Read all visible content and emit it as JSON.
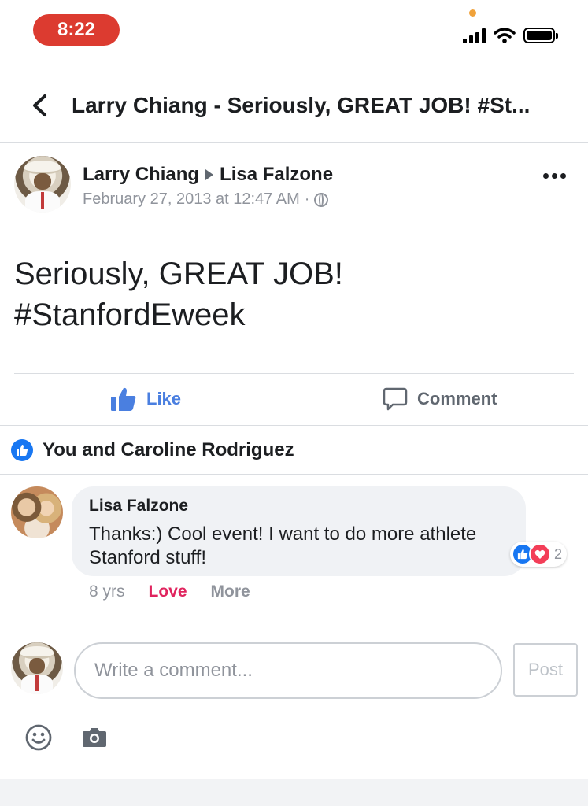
{
  "status_bar": {
    "time": "8:22"
  },
  "header": {
    "title": "Larry Chiang - Seriously, GREAT JOB! #St..."
  },
  "post": {
    "author": "Larry Chiang",
    "recipient": "Lisa Falzone",
    "timestamp": "February 27, 2013 at 12:47 AM",
    "separator": "·",
    "text_line1": "Seriously, GREAT JOB!",
    "text_line2": "#StanfordEweek"
  },
  "actions": {
    "like_label": "Like",
    "comment_label": "Comment"
  },
  "reactions_summary": "You and Caroline Rodriguez",
  "comment": {
    "author": "Lisa Falzone",
    "text": "Thanks:) Cool event! I want to do more athlete Stanford stuff!",
    "reaction_count": "2",
    "age": "8 yrs",
    "love_label": "Love",
    "more_label": "More"
  },
  "composer": {
    "placeholder": "Write a comment...",
    "post_label": "Post"
  },
  "icons": [
    "back-chevron-icon",
    "globe-icon",
    "more-icon",
    "like-icon",
    "comment-icon",
    "emoji-icon",
    "camera-icon"
  ],
  "colors": {
    "time_pill": "#dc3b30",
    "like_blue": "#4a7fe0",
    "love_red": "#e0245e",
    "bubble_bg": "#f0f2f5"
  }
}
